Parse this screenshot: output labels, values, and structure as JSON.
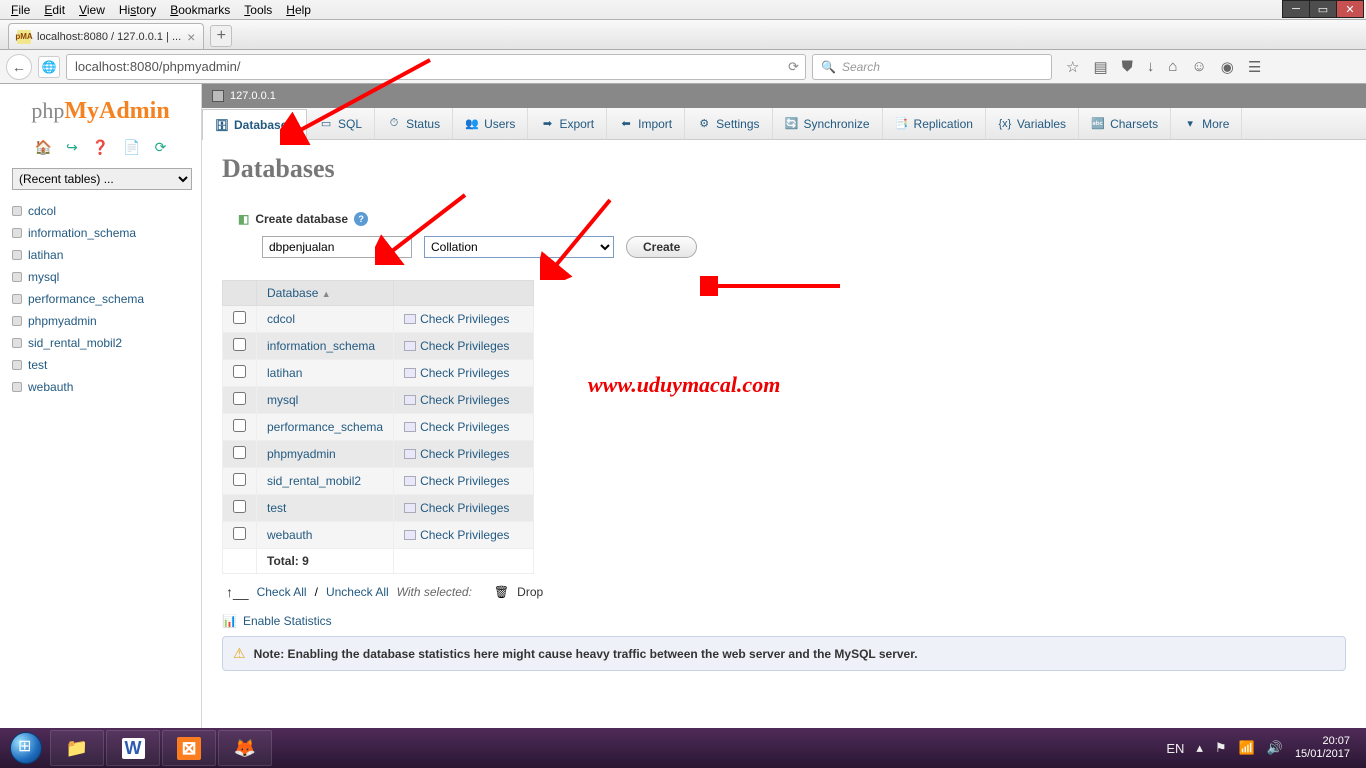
{
  "browser": {
    "menus": [
      "File",
      "Edit",
      "View",
      "History",
      "Bookmarks",
      "Tools",
      "Help"
    ],
    "tab_title": "localhost:8080 / 127.0.0.1 | ...",
    "url": "localhost:8080/phpmyadmin/",
    "search_placeholder": "Search"
  },
  "sidebar": {
    "recent_label": "(Recent tables) ...",
    "databases": [
      "cdcol",
      "information_schema",
      "latihan",
      "mysql",
      "performance_schema",
      "phpmyadmin",
      "sid_rental_mobil2",
      "test",
      "webauth"
    ]
  },
  "server": {
    "host": "127.0.0.1"
  },
  "tabs": [
    "Databases",
    "SQL",
    "Status",
    "Users",
    "Export",
    "Import",
    "Settings",
    "Synchronize",
    "Replication",
    "Variables",
    "Charsets",
    "More"
  ],
  "page": {
    "title": "Databases",
    "create_label": "Create database",
    "dbname_value": "dbpenjualan",
    "collation_placeholder": "Collation",
    "create_btn": "Create"
  },
  "table": {
    "col_database": "Database",
    "check_priv": "Check Privileges",
    "rows": [
      "cdcol",
      "information_schema",
      "latihan",
      "mysql",
      "performance_schema",
      "phpmyadmin",
      "sid_rental_mobil2",
      "test",
      "webauth"
    ],
    "total_label": "Total: 9"
  },
  "footer": {
    "check_all": "Check All",
    "uncheck_all": "Uncheck All",
    "with_selected": "With selected:",
    "drop": "Drop",
    "enable_stats": "Enable Statistics",
    "note": "Note: Enabling the database statistics here might cause heavy traffic between the web server and the MySQL server."
  },
  "watermark": "www.uduymacal.com",
  "tray": {
    "lang": "EN",
    "time": "20:07",
    "date": "15/01/2017"
  }
}
